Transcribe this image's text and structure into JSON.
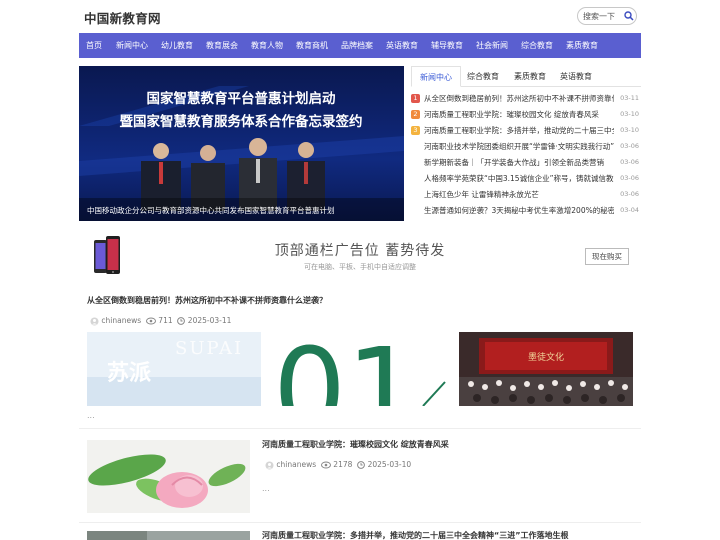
{
  "site": {
    "title": "中国新教育网",
    "search_placeholder": "搜索一下"
  },
  "nav": {
    "items": [
      "首页",
      "新闻中心",
      "幼儿教育",
      "教育展会",
      "教育人物",
      "教育商机",
      "品牌档案",
      "英语教育",
      "辅导教育",
      "社会新闻",
      "综合教育",
      "素质教育"
    ]
  },
  "slider": {
    "heading_line1": "国家智慧教育平台普惠计划启动",
    "heading_line2": "暨国家智慧教育服务体系合作备忘录签约",
    "caption": "中国移动政企分公司与教育部资源中心共同发布国家智慧教育平台普惠计划"
  },
  "tabs": [
    "新闻中心",
    "综合教育",
    "素质教育",
    "英语教育"
  ],
  "news": [
    {
      "rank": "1",
      "title": "从全区倒数到稳居前列！苏州这所初中不补课不拼师资靠什么逆袭？",
      "date": "03-11"
    },
    {
      "rank": "2",
      "title": "河南质量工程职业学院：璀璨校园文化 绽放青春风采",
      "date": "03-10"
    },
    {
      "rank": "3",
      "title": "河南质量工程职业学院：多措并举，推动党的二十届三中全会精神",
      "date": "03-10"
    },
    {
      "rank": "4",
      "title": "河南职业技术学院团委组织开展“学雷锋·文明实践我行动”志愿",
      "date": "03-06"
    },
    {
      "rank": "5",
      "title": "新学期新装备｜「开学装备大作战」引领全新品类营销",
      "date": "03-06"
    },
    {
      "rank": "6",
      "title": "人格频率学苑荣获“中国3.15诚信企业”称号，铸就诚信教育标杆",
      "date": "03-06"
    },
    {
      "rank": "7",
      "title": "上海红色少年 让雷锋精神永放光芒",
      "date": "03-06"
    },
    {
      "rank": "8",
      "title": "生源普通如何逆袭？3天揭秘中考优生率激增200%的秘密",
      "date": "03-04"
    }
  ],
  "ad": {
    "title": "顶部通栏广告位 蓄势待发",
    "subtitle": "可在电脑、平板、手机中自适应调整",
    "button": "现在购买"
  },
  "articles": [
    {
      "title": "从全区倒数到稳居前列！苏州这所初中不补课不拼师资靠什么逆袭？",
      "author": "chinanews",
      "views": "711",
      "date": "2025-03-11",
      "img1_text": "苏派",
      "img1_watermark": "SUPAI",
      "img2_text": "01",
      "img3_text": "墨徒文化",
      "excerpt": "..."
    },
    {
      "title": "河南质量工程职业学院：璀璨校园文化 绽放青春风采",
      "author": "chinanews",
      "views": "2178",
      "date": "2025-03-10",
      "excerpt": "..."
    },
    {
      "title": "河南质量工程职业学院：多措并举，推动党的二十届三中全会精神“三进”工作落地生根"
    }
  ],
  "colors": {
    "nav_bg": "#5a5fd0",
    "tab_active": "#3b5bd6",
    "rank1": "#e2574c",
    "rank2": "#f08a3c",
    "rank3": "#f4b33f"
  }
}
